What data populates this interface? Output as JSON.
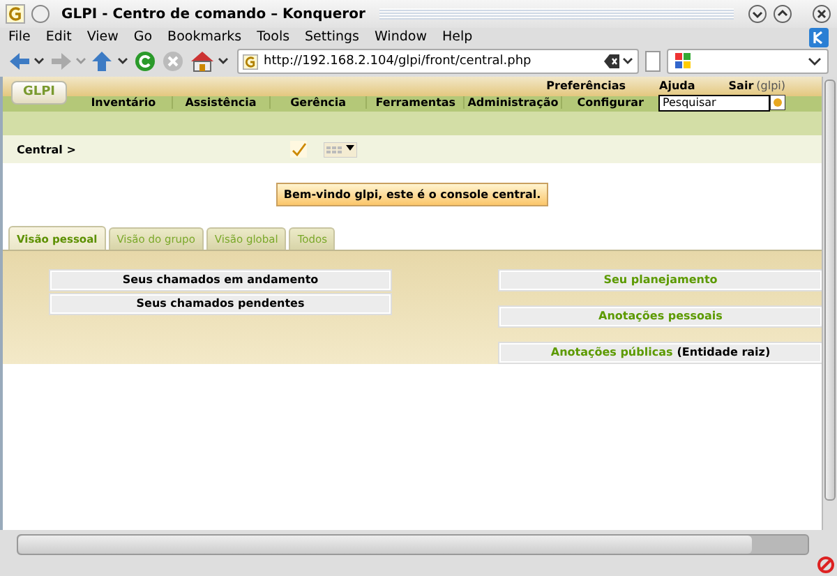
{
  "window": {
    "title": "GLPI - Centro de comando – Konqueror"
  },
  "menu": [
    "File",
    "Edit",
    "View",
    "Go",
    "Bookmarks",
    "Tools",
    "Settings",
    "Window",
    "Help"
  ],
  "location": {
    "url": "http://192.168.2.104/glpi/front/central.php"
  },
  "header": {
    "logo": "GLPI",
    "top_links": [
      {
        "label": "Preferências"
      },
      {
        "label": "Ajuda"
      },
      {
        "label": "Sair",
        "note": "(glpi)"
      }
    ],
    "nav": [
      "Inventário",
      "Assistência",
      "Gerência",
      "Ferramentas",
      "Administração",
      "Configurar"
    ],
    "search": {
      "placeholder": "Pesquisar"
    }
  },
  "breadcrumb": "Central >",
  "message": "Bem-vindo glpi, este é o console central.",
  "tabs": [
    {
      "label": "Visão pessoal",
      "selected": true
    },
    {
      "label": "Visão do grupo",
      "selected": false
    },
    {
      "label": "Visão global",
      "selected": false
    },
    {
      "label": "Todos",
      "selected": false
    }
  ],
  "left_sections": [
    "Seus chamados em andamento",
    "Seus chamados pendentes"
  ],
  "right_sections": [
    {
      "link": "Seu planejamento"
    },
    {
      "link": "Anotações pessoais"
    },
    {
      "link": "Anotações públicas",
      "extra": "(Entidade raiz)"
    }
  ]
}
